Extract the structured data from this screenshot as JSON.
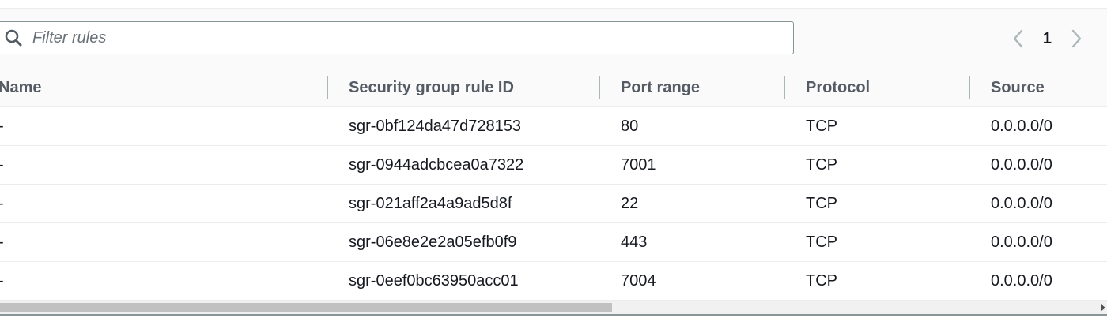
{
  "search": {
    "placeholder": "Filter rules",
    "value": ""
  },
  "pagination": {
    "current_page": "1"
  },
  "table": {
    "columns": [
      "Name",
      "Security group rule ID",
      "Port range",
      "Protocol",
      "Source"
    ],
    "rows": [
      [
        "-",
        "sgr-0bf124da47d728153",
        "80",
        "TCP",
        "0.0.0.0/0"
      ],
      [
        "-",
        "sgr-0944adcbcea0a7322",
        "7001",
        "TCP",
        "0.0.0.0/0"
      ],
      [
        "-",
        "sgr-021aff2a4a9ad5d8f",
        "22",
        "TCP",
        "0.0.0.0/0"
      ],
      [
        "-",
        "sgr-06e8e2e2a05efb0f9",
        "443",
        "TCP",
        "0.0.0.0/0"
      ],
      [
        "-",
        "sgr-0eef0bc63950acc01",
        "7004",
        "TCP",
        "0.0.0.0/0"
      ]
    ]
  },
  "icons": {
    "search": "search-icon",
    "prev": "chevron-left-icon",
    "next": "chevron-right-icon"
  }
}
